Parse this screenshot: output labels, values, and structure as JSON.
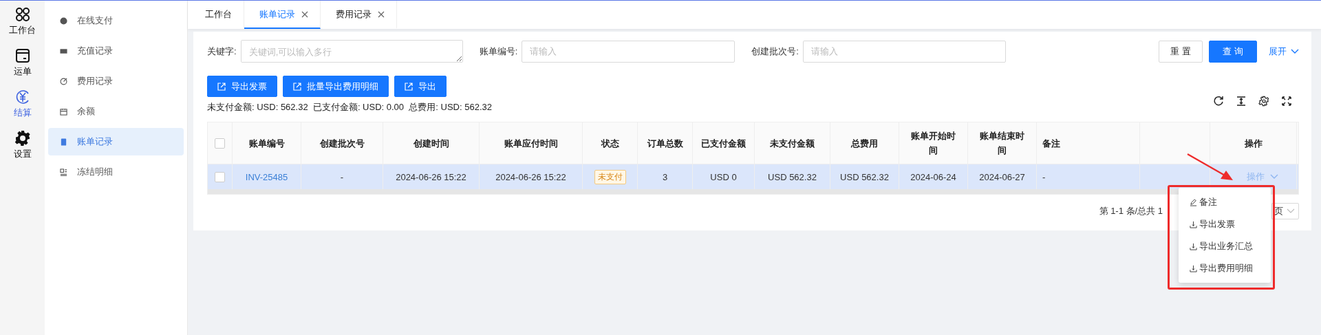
{
  "rail": [
    {
      "label": "工作台",
      "selected": false
    },
    {
      "label": "运单",
      "selected": false
    },
    {
      "label": "结算",
      "selected": true
    },
    {
      "label": "设置",
      "selected": false
    }
  ],
  "submenu": [
    {
      "label": "在线支付",
      "selected": false
    },
    {
      "label": "充值记录",
      "selected": false
    },
    {
      "label": "费用记录",
      "selected": false
    },
    {
      "label": "余额",
      "selected": false
    },
    {
      "label": "账单记录",
      "selected": true
    },
    {
      "label": "冻结明细",
      "selected": false
    }
  ],
  "tabs": [
    {
      "label": "工作台",
      "closable": false,
      "selected": false
    },
    {
      "label": "账单记录",
      "closable": true,
      "selected": true
    },
    {
      "label": "费用记录",
      "closable": true,
      "selected": false
    }
  ],
  "filters": [
    {
      "label": "关键字:",
      "kind": "textarea",
      "placeholder": "关键词,可以输入多行"
    },
    {
      "label": "账单编号:",
      "kind": "input",
      "placeholder": "请输入"
    },
    {
      "label": "创建批次号:",
      "kind": "input",
      "placeholder": "请输入"
    }
  ],
  "reset_button": "重 置",
  "search_button": "查 询",
  "expand_link": "展开",
  "export_buttons": [
    "导出发票",
    "批量导出费用明细",
    "导出"
  ],
  "summary": "未支付金额: USD: 562.32  已支付金额: USD: 0.00  总费用: USD: 562.32",
  "table": {
    "header_checked": false,
    "columns": [
      "账单编号",
      "创建批次号",
      "创建时间",
      "账单应付时间",
      "状态",
      "订单总数",
      "已支付金额",
      "未支付金额",
      "总费用",
      "账单开始时间",
      "账单结束时间",
      "备注",
      "",
      "操作"
    ],
    "rows": [
      {
        "selected": true,
        "checked": false,
        "cells": [
          "INV-25485",
          "-",
          "2024-06-26 15:22",
          "2024-06-26 15:22",
          "未支付",
          "3",
          "USD 0",
          "USD 562.32",
          "USD 562.32",
          "2024-06-24",
          "2024-06-27",
          "-",
          "",
          "操作"
        ]
      }
    ]
  },
  "pagination": {
    "range": "第 1-1 条/总共 1",
    "page_size": "页"
  },
  "action_menu": [
    {
      "label": "备注",
      "kind": "edit"
    },
    {
      "label": "导出发票",
      "kind": "download"
    },
    {
      "label": "导出业务汇总",
      "kind": "download"
    },
    {
      "label": "导出费用明细",
      "kind": "download"
    }
  ]
}
